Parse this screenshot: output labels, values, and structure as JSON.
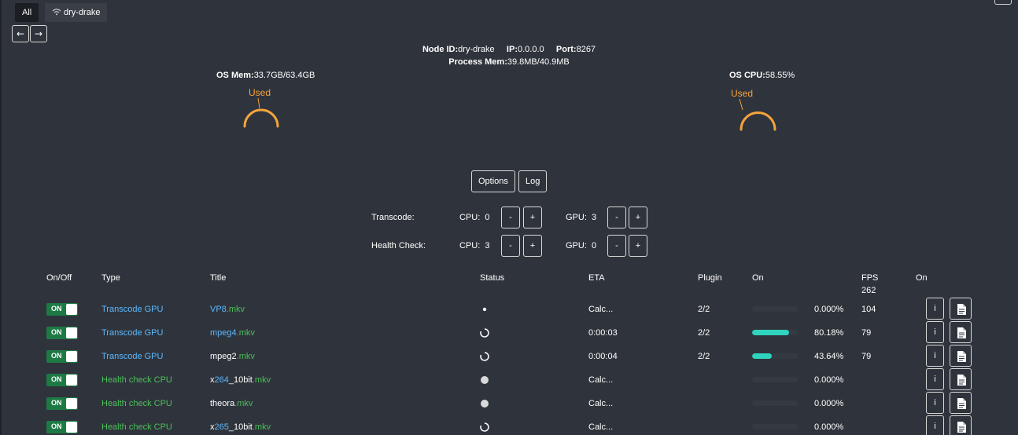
{
  "tabs": [
    {
      "label": "All",
      "active": true
    },
    {
      "label": "dry-drake",
      "icon": "wifi-icon",
      "active": false
    }
  ],
  "nav": {
    "back": "←",
    "forward": "→"
  },
  "node": {
    "id_label": "Node ID:",
    "id_value": "dry-drake",
    "ip_label": "IP:",
    "ip_value": "0.0.0.0",
    "port_label": "Port:",
    "port_value": "8267",
    "proc_label": "Process Mem:",
    "proc_value": "39.8MB/40.9MB"
  },
  "os_mem": {
    "label": "OS Mem:",
    "value": "33.7GB/63.4GB",
    "used_label": "Used",
    "used_fraction": 0.53
  },
  "os_cpu": {
    "label": "OS CPU:",
    "value": "58.55%",
    "used_label": "Used",
    "used_fraction": 0.5855
  },
  "buttons": {
    "options": "Options",
    "log": "Log"
  },
  "workers": {
    "transcode": {
      "label": "Transcode:",
      "cpu_label": "CPU:",
      "cpu": "0",
      "gpu_label": "GPU:",
      "gpu": "3"
    },
    "health": {
      "label": "Health Check:",
      "cpu_label": "CPU:",
      "cpu": "3",
      "gpu_label": "GPU:",
      "gpu": "0"
    },
    "minus": "-",
    "plus": "+"
  },
  "table": {
    "headers": {
      "onoff": "On/Off",
      "type": "Type",
      "title": "Title",
      "status": "Status",
      "eta": "ETA",
      "plugin": "Plugin",
      "on": "On",
      "fps": "FPS",
      "fps_total": "262",
      "on2": "On"
    },
    "rows": [
      {
        "toggle": "ON",
        "type": "Transcode GPU",
        "kind": "gpu",
        "title_parts": [
          {
            "t": "VP8",
            "c": "blue"
          },
          {
            "t": ".mkv",
            "c": "green"
          }
        ],
        "status": "dot",
        "eta": "Calc...",
        "plugin": "2/2",
        "progress": 0.0,
        "percent": "0.000%",
        "fps": "104",
        "info": "i"
      },
      {
        "toggle": "ON",
        "type": "Transcode GPU",
        "kind": "gpu",
        "title_parts": [
          {
            "t": "mpeg4",
            "c": "blue"
          },
          {
            "t": ".mkv",
            "c": "green"
          }
        ],
        "status": "spinner",
        "eta": "0:00:03",
        "plugin": "2/2",
        "progress": 0.8018,
        "percent": "80.18%",
        "fps": "79",
        "info": "i"
      },
      {
        "toggle": "ON",
        "type": "Transcode GPU",
        "kind": "gpu",
        "title_parts": [
          {
            "t": "mpeg2",
            "c": "white"
          },
          {
            "t": ".mkv",
            "c": "green"
          }
        ],
        "status": "spinner",
        "eta": "0:00:04",
        "plugin": "2/2",
        "progress": 0.4364,
        "percent": "43.64%",
        "fps": "79",
        "info": "i"
      },
      {
        "toggle": "ON",
        "type": "Health check CPU",
        "kind": "cpu",
        "title_parts": [
          {
            "t": "x",
            "c": "white"
          },
          {
            "t": "264",
            "c": "blue"
          },
          {
            "t": "_10bit",
            "c": "white"
          },
          {
            "t": ".mkv",
            "c": "green"
          }
        ],
        "status": "circle",
        "eta": "Calc...",
        "plugin": "",
        "progress": 0.0,
        "percent": "0.000%",
        "fps": "",
        "info": "i"
      },
      {
        "toggle": "ON",
        "type": "Health check CPU",
        "kind": "cpu",
        "title_parts": [
          {
            "t": "theora",
            "c": "white"
          },
          {
            "t": ".mkv",
            "c": "green"
          }
        ],
        "status": "circle",
        "eta": "Calc...",
        "plugin": "",
        "progress": 0.0,
        "percent": "0.000%",
        "fps": "",
        "info": "i"
      },
      {
        "toggle": "ON",
        "type": "Health check CPU",
        "kind": "cpu",
        "title_parts": [
          {
            "t": "x",
            "c": "white"
          },
          {
            "t": "265",
            "c": "blue"
          },
          {
            "t": "_10bit",
            "c": "white"
          },
          {
            "t": ".mkv",
            "c": "green"
          }
        ],
        "status": "spinner",
        "eta": "Calc...",
        "plugin": "",
        "progress": 0.0,
        "percent": "0.000%",
        "fps": "",
        "info": "i"
      }
    ]
  },
  "colors": {
    "gauge": "#f5a33c",
    "progress": "#2fd4bd",
    "toggle": "#1e7a44",
    "gpu_type": "#5cb8ff",
    "cpu_type": "#4cbf5a"
  }
}
